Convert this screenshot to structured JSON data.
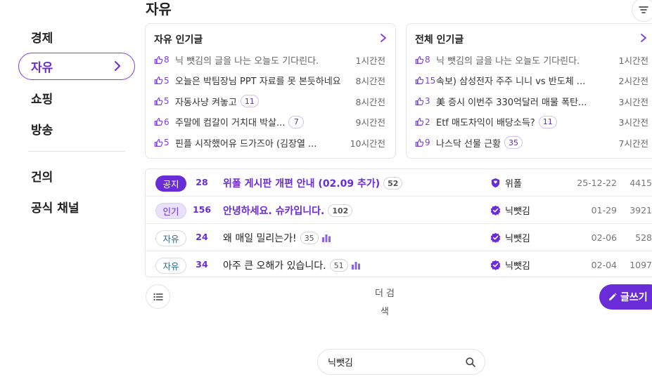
{
  "sidebar": {
    "items": [
      {
        "label": "경제",
        "active": false
      },
      {
        "label": "자유",
        "active": true
      },
      {
        "label": "쇼핑",
        "active": false
      },
      {
        "label": "방송",
        "active": false
      },
      {
        "label": "건의",
        "active": false
      },
      {
        "label": "공식 채널",
        "active": false
      }
    ]
  },
  "header": {
    "title": "자유"
  },
  "popular_free": {
    "title": "자유 인기글",
    "posts": [
      {
        "likes": "8",
        "title": "닉 뺏김의 글을 나는 오늘도 기다린다.",
        "comments": "",
        "time": "1시간전",
        "gray": true
      },
      {
        "likes": "5",
        "title": "오늘은 박팀장님 PPT 자료를 못 본듯하네요",
        "comments": "",
        "time": "8시간전",
        "gray": false
      },
      {
        "likes": "5",
        "title": "자동사냥 켜놓고",
        "comments": "11",
        "time": "8시간전",
        "gray": false
      },
      {
        "likes": "6",
        "title": "주말에 컴갈이 거치대 박살...",
        "comments": "7",
        "time": "9시간전",
        "gray": false
      },
      {
        "likes": "5",
        "title": "핀플 시작했어유 드가즈아 (김장열 ...",
        "comments": "",
        "time": "10시간전",
        "gray": false
      }
    ]
  },
  "popular_all": {
    "title": "전체 인기글",
    "posts": [
      {
        "likes": "8",
        "title": "닉 뺏김의 글을 나는 오늘도 기다린다.",
        "comments": "",
        "time": "1시간전",
        "gray": true
      },
      {
        "likes": "15",
        "title": "속보) 삼성전자 주주 니니 vs 반도체 ...",
        "comments": "",
        "time": "2시간전",
        "gray": false
      },
      {
        "likes": "3",
        "title": "美 증시 이번주 330억달러 매물 폭탄...",
        "comments": "",
        "time": "3시간전",
        "gray": false
      },
      {
        "likes": "2",
        "title": "Etf 매도차익이 배당소득?",
        "comments": "11",
        "time": "3시간전",
        "gray": false
      },
      {
        "likes": "9",
        "title": "나스닥 선물 근황",
        "comments": "35",
        "time": "7시간전",
        "gray": false
      }
    ]
  },
  "board": {
    "rows": [
      {
        "tag": "공지",
        "tag_type": "notice",
        "num": "28",
        "title": "위폴 게시판 개편 안내 (02.09 추가)",
        "comments": "52",
        "chart": false,
        "title_style": "purple",
        "author": "위폴",
        "author_icon": "shield-icon",
        "date": "25-12-22",
        "views": "4415"
      },
      {
        "tag": "인기",
        "tag_type": "popular",
        "num": "156",
        "title": "안녕하세요. 슈카입니다.",
        "comments": "102",
        "chart": false,
        "title_style": "purple",
        "author": "닉뺏김",
        "author_icon": "verified-icon",
        "date": "01-29",
        "views": "3921"
      },
      {
        "tag": "자유",
        "tag_type": "free",
        "num": "24",
        "title": "왜 매일 밀리는가!",
        "comments": "35",
        "chart": true,
        "title_style": "normal",
        "author": "닉뺏김",
        "author_icon": "verified-icon",
        "date": "02-06",
        "views": "528"
      },
      {
        "tag": "자유",
        "tag_type": "free",
        "num": "34",
        "title": "아주 큰 오해가 있습니다.",
        "comments": "51",
        "chart": true,
        "title_style": "normal",
        "author": "닉뺏김",
        "author_icon": "verified-icon",
        "date": "02-04",
        "views": "1097"
      }
    ]
  },
  "footer": {
    "more_search_line1": "더 검",
    "more_search_line2": "색",
    "write_label": "글쓰기",
    "search_value": "닉뺏김"
  },
  "colors": {
    "accent": "#6a2bd9",
    "accent_light": "#e9e1fb",
    "free_tag_text": "#2b6e8a"
  }
}
